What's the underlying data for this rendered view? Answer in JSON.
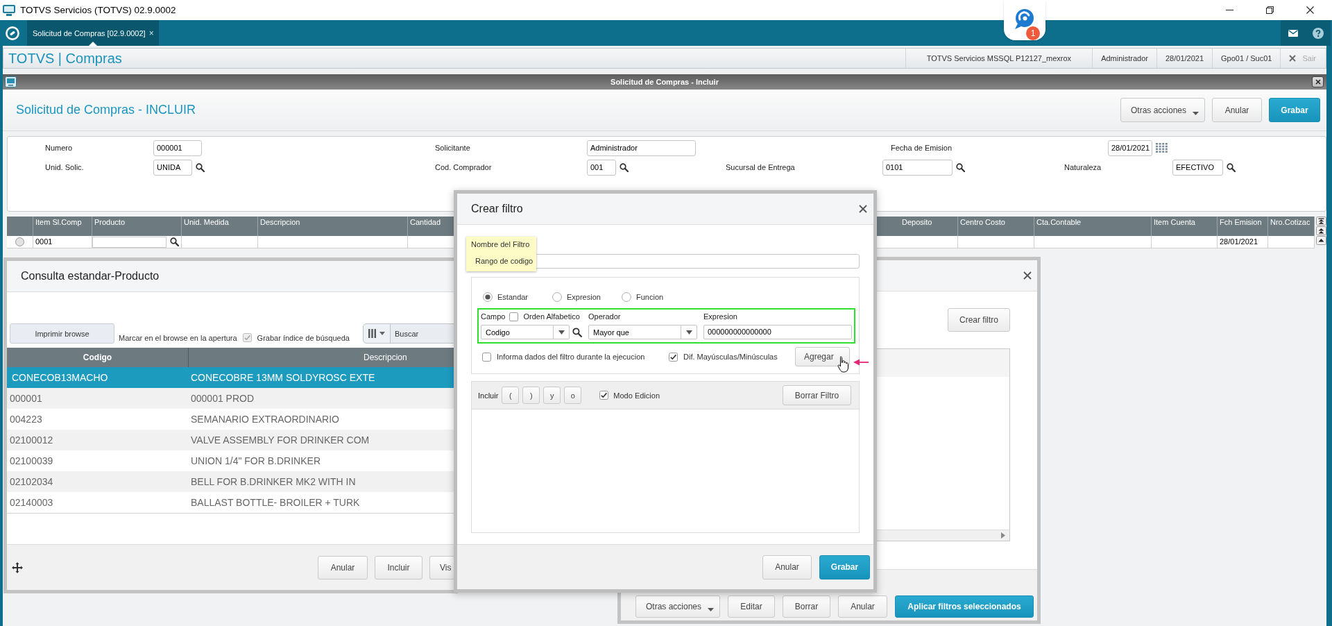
{
  "window": {
    "title": "TOTVS Servicios (TOTVS) 02.9.0002"
  },
  "tab_bar": {
    "tabs": [
      {
        "label": "Solicitud de Compras [02.9.0002]",
        "close": "×",
        "selected": true
      }
    ],
    "chat": {
      "badge": "1"
    }
  },
  "app_header": {
    "title": "TOTVS | Compras",
    "info": [
      "TOTVS Servicios MSSQL P12127_mexrox",
      "Administrador",
      "28/01/2021",
      "Gpo01 / Suc01"
    ],
    "exit": {
      "label": "Sair",
      "disabled": true
    }
  },
  "inner_window": {
    "title": "Solicitud de Compras - Incluir"
  },
  "form_header": {
    "title": "Solicitud de Compras - INCLUIR",
    "buttons": [
      {
        "label": "Otras acciones",
        "kind": "menu"
      },
      {
        "label": "Anular",
        "kind": "default"
      },
      {
        "label": "Grabar",
        "kind": "primary"
      }
    ]
  },
  "form": {
    "rows": [
      [
        {
          "label": "Numero",
          "value": "000001",
          "kind": "text"
        },
        {
          "label": "Solicitante",
          "value": "Administrador",
          "kind": "text"
        },
        {
          "label": "Fecha de Emision",
          "value": "28/01/2021",
          "kind": "date"
        }
      ],
      [
        {
          "label": "Unid. Solic.",
          "value": "UNIDA",
          "kind": "lookup"
        },
        {
          "label": "Cod. Comprador",
          "value": "001",
          "kind": "lookup"
        },
        {
          "label": "Sucursal de Entrega",
          "value": "0101",
          "kind": "lookup"
        },
        {
          "label": "Naturaleza",
          "value": "EFECTIVO",
          "kind": "lookup"
        }
      ]
    ]
  },
  "grid": {
    "row": {
      "selected": false
    },
    "columns": [
      {
        "label": "Item Sl.Comp",
        "kind": "text",
        "cell": "0001"
      },
      {
        "label": "Producto",
        "kind": "lookup"
      },
      {
        "label": "Unid. Medida",
        "kind": "text"
      },
      {
        "label": "Descripcion",
        "kind": "text"
      },
      {
        "label": "Cantidad",
        "kind": "text"
      },
      {
        "label": "Deposito",
        "kind": "text"
      },
      {
        "label": "Centro Costo",
        "kind": "text"
      },
      {
        "label": "Cta.Contable",
        "kind": "text"
      },
      {
        "label": "Item Cuenta",
        "kind": "text"
      },
      {
        "label": "Fch Emision",
        "kind": "text",
        "cell": "28/01/2021"
      },
      {
        "label": "Nro.Cotizac",
        "kind": "text"
      }
    ]
  },
  "lookup_dialog": {
    "title": "Consulta estandar-Producto",
    "print_button": "Imprimir browse",
    "mark_label": "Marcar en el browse en la apertura",
    "save_index": {
      "label": "Grabar índice de búsqueda",
      "checked": true,
      "disabled": true
    },
    "search": {
      "placeholder": "Buscar"
    },
    "columns": [
      "Codigo",
      "Descripcion"
    ],
    "rows": [
      {
        "code": "CONECOB13MACHO",
        "description": "CONECOBRE 13MM SOLDYROSC EXTE",
        "selected": true
      },
      {
        "code": "000001",
        "description": "000001 PROD",
        "selected": false
      },
      {
        "code": "004223",
        "description": "SEMANARIO EXTRAORDINARIO",
        "selected": false
      },
      {
        "code": "02100012",
        "description": "VALVE ASSEMBLY FOR DRINKER COM",
        "selected": false
      },
      {
        "code": "02100039",
        "description": "UNION 1/4\" FOR B.DRINKER",
        "selected": false
      },
      {
        "code": "02102034",
        "description": "BELL FOR B.DRINKER MK2 WITH IN",
        "selected": false
      },
      {
        "code": "02140003",
        "description": "BALLAST BOTTLE- BROILER + TURK",
        "selected": false
      }
    ],
    "buttons": [
      "Anular",
      "Incluir",
      "Vis"
    ]
  },
  "filter_dialog": {
    "title": "Crear filtro",
    "name_field": {
      "label": "Nombre del Filtro",
      "value": "Rango de codigo",
      "highlighted": true
    },
    "modes": [
      {
        "label": "Estandar",
        "selected": true
      },
      {
        "label": "Expresion",
        "selected": false
      },
      {
        "label": "Funcion",
        "selected": false
      }
    ],
    "condition": {
      "highlighted": true,
      "field_label": "Campo",
      "alpha_order": {
        "label": "Orden Alfabetico",
        "checked": false
      },
      "operator_label": "Operador",
      "expression_label": "Expresion",
      "field_value": "Codigo",
      "operator_value": "Mayor que",
      "expression_value": "000000000000000"
    },
    "options": [
      {
        "label": "Informa dados del filtro durante la ejecucion",
        "checked": false
      },
      {
        "label": "Dif. Mayúsculas/Minúsculas",
        "checked": true
      }
    ],
    "add_button": "Agregar",
    "builder": {
      "label": "Incluir",
      "operators": [
        "(",
        ")",
        "y",
        "o"
      ],
      "edit_mode": {
        "label": "Modo Edicion",
        "checked": true
      },
      "clear_button": "Borrar Filtro"
    },
    "buttons": [
      {
        "label": "Anular",
        "kind": "default"
      },
      {
        "label": "Grabar",
        "kind": "primary"
      }
    ]
  },
  "filters_dialog": {
    "create_button": "Crear filtro",
    "buttons": [
      {
        "label": "Otras acciones",
        "kind": "menu"
      },
      {
        "label": "Editar",
        "kind": "default"
      },
      {
        "label": "Borrar",
        "kind": "default"
      },
      {
        "label": "Anular",
        "kind": "default"
      },
      {
        "label": "Aplicar filtros seleccionados",
        "kind": "primary"
      }
    ]
  }
}
